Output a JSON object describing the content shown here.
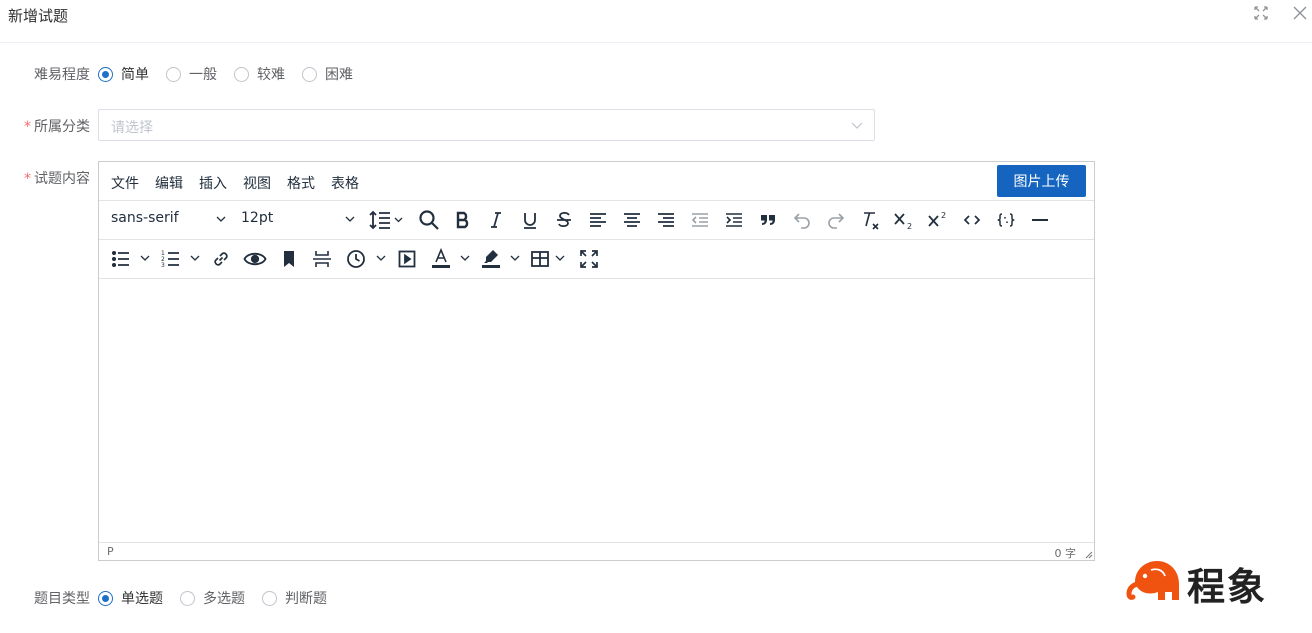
{
  "dialog": {
    "title": "新增试题",
    "maximize_icon": "expand-icon",
    "close_icon": "close-icon"
  },
  "difficulty": {
    "label": "难易程度",
    "options": [
      "简单",
      "一般",
      "较难",
      "困难"
    ],
    "selected": "简单"
  },
  "category": {
    "required_mark": "*",
    "label": "所属分类",
    "placeholder": "请选择",
    "value": ""
  },
  "content": {
    "required_mark": "*",
    "label": "试题内容",
    "menus": [
      "文件",
      "编辑",
      "插入",
      "视图",
      "格式",
      "表格"
    ],
    "upload_label": "图片上传",
    "font_family": "sans-serif",
    "font_size": "12pt",
    "status_path": "P",
    "word_count": "0 字",
    "text": ""
  },
  "question_type": {
    "label": "题目类型",
    "options": [
      "单选题",
      "多选题",
      "判断题"
    ],
    "selected": "单选题"
  },
  "brand": {
    "name": "程象",
    "color": "#f0530f"
  },
  "colors": {
    "accent": "#1565c0",
    "required": "#f56c6c"
  }
}
